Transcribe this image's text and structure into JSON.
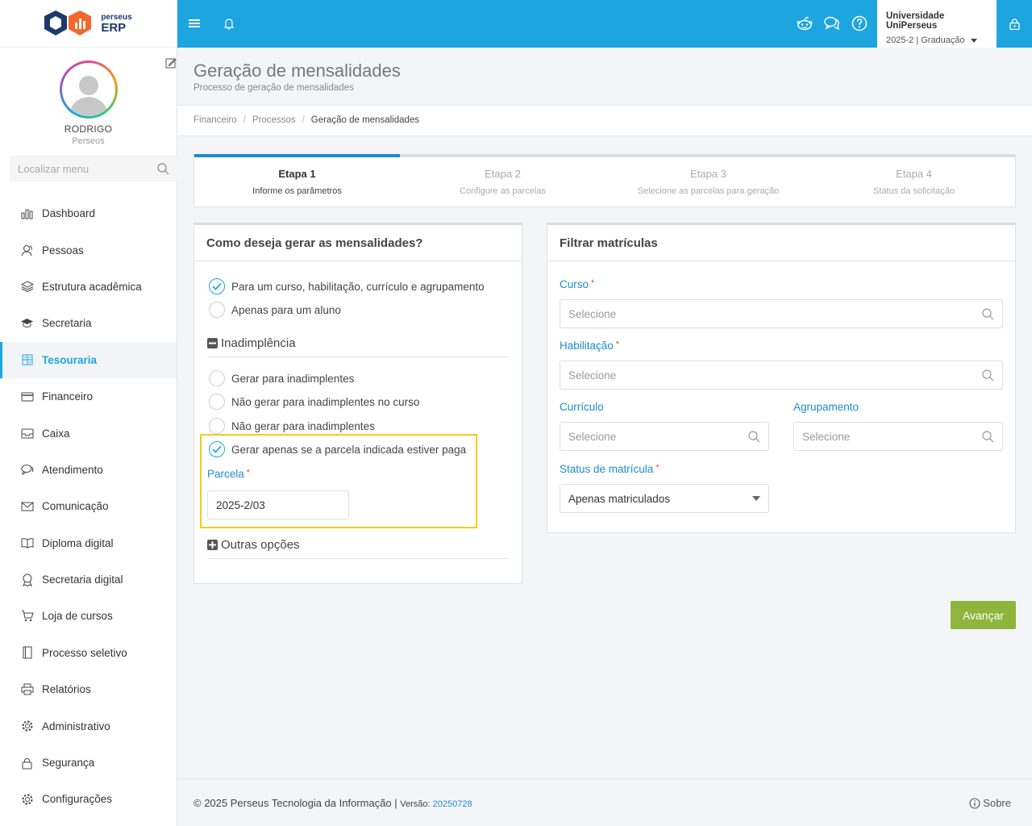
{
  "logo": {
    "line1": "perseus",
    "line2": "ERP"
  },
  "profile": {
    "name": "RODRIGO",
    "subtitle": "Perseus"
  },
  "menu_search": {
    "placeholder": "Localizar menu"
  },
  "menu": [
    {
      "label": "Dashboard",
      "icon": "bar-chart-icon"
    },
    {
      "label": "Pessoas",
      "icon": "people-icon"
    },
    {
      "label": "Estrutura acadêmica",
      "icon": "layers-icon"
    },
    {
      "label": "Secretaria",
      "icon": "graduation-cap-icon"
    },
    {
      "label": "Tesouraria",
      "icon": "calculator-icon",
      "active": true
    },
    {
      "label": "Financeiro",
      "icon": "credit-card-icon"
    },
    {
      "label": "Caixa",
      "icon": "inbox-icon"
    },
    {
      "label": "Atendimento",
      "icon": "chat-icon"
    },
    {
      "label": "Comunicação",
      "icon": "envelope-icon"
    },
    {
      "label": "Diploma digital",
      "icon": "book-icon"
    },
    {
      "label": "Secretaria digital",
      "icon": "award-icon"
    },
    {
      "label": "Loja de cursos",
      "icon": "cart-icon"
    },
    {
      "label": "Processo seletivo",
      "icon": "notebook-icon"
    },
    {
      "label": "Relatórios",
      "icon": "printer-icon"
    },
    {
      "label": "Administrativo",
      "icon": "cog-icon"
    },
    {
      "label": "Segurança",
      "icon": "lock-icon"
    },
    {
      "label": "Configurações",
      "icon": "settings-icon"
    }
  ],
  "topbar": {
    "university": "Universidade UniPerseus",
    "period": "2025-2 | Graduação",
    "accent": "#1da5e0"
  },
  "header": {
    "title": "Geração de mensalidades",
    "subtitle": "Processo de geração de mensalidades"
  },
  "breadcrumb": [
    "Financeiro",
    "Processos",
    "Geração de mensalidades"
  ],
  "steps": [
    {
      "title": "Etapa 1",
      "sub": "Informe os parâmetros",
      "active": true
    },
    {
      "title": "Etapa 2",
      "sub": "Configure as parcelas"
    },
    {
      "title": "Etapa 3",
      "sub": "Selecione as parcelas para geração"
    },
    {
      "title": "Etapa 4",
      "sub": "Status da solicitação"
    }
  ],
  "steps_progress": 0.25,
  "left_panel": {
    "title": "Como deseja gerar as mensalidades?",
    "mode_options": [
      {
        "label": "Para um curso, habilitação, currículo e agrupamento",
        "checked": true
      },
      {
        "label": "Apenas para um aluno",
        "checked": false
      }
    ],
    "inadimplencia_title": "Inadimplência",
    "inadimplencia_options": [
      {
        "label": "Gerar para inadimplentes",
        "checked": false
      },
      {
        "label": "Não gerar para inadimplentes no curso",
        "checked": false
      },
      {
        "label": "Não gerar para inadimplentes",
        "checked": false
      },
      {
        "label": "Gerar apenas se a parcela indicada estiver paga",
        "checked": true
      }
    ],
    "parcela_label": "Parcela",
    "parcela_value": "2025-2/03",
    "outras_title": "Outras opções"
  },
  "right_panel": {
    "title": "Filtrar matrículas",
    "curso_label": "Curso",
    "curso_placeholder": "Selecione",
    "habilitacao_label": "Habilitação",
    "habilitacao_placeholder": "Selecione",
    "curriculo_label": "Currículo",
    "curriculo_placeholder": "Selecione",
    "agrupamento_label": "Agrupamento",
    "agrupamento_placeholder": "Selecione",
    "status_label": "Status de matrícula",
    "status_value": "Apenas matriculados",
    "required_mark": "*"
  },
  "advance_button": "Avançar",
  "footer": {
    "copyright": "© 2025 Perseus Tecnologia da Informação | ",
    "version_label": "Versão: ",
    "version": "20250728",
    "about": "Sobre"
  }
}
